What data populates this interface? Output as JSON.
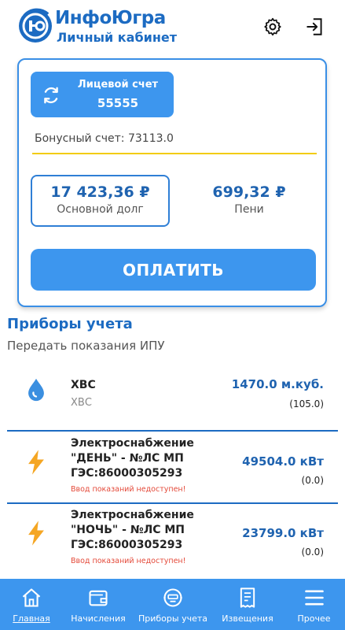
{
  "header": {
    "brand": "ИнфоЮгра",
    "subtitle": "Личный кабинет",
    "settings_icon": "gear-icon",
    "logout_icon": "logout-icon"
  },
  "account": {
    "label": "Лицевой счет",
    "number": "55555",
    "bonus": "Бонусный счет: 73113.0",
    "debt_amount": "17 423,36 ₽",
    "debt_label": "Основной долг",
    "peni_amount": "699,32 ₽",
    "peni_label": "Пени",
    "pay_label": "ОПЛАТИТЬ"
  },
  "meters": {
    "title": "Приборы учета",
    "subtitle": "Передать показания ИПУ",
    "items": [
      {
        "name": "ХВС",
        "sub": "ХВС",
        "value": "1470.0 м.куб.",
        "prev": "(105.0)",
        "icon": "water-drop-icon"
      },
      {
        "name": [
          "Электроснабжение",
          "\"ДЕНЬ\" - №ЛС МП",
          "ГЭС:86000305293"
        ],
        "warning": "Ввод показаний недоступен!",
        "value": "49504.0 кВт",
        "prev": "(0.0)",
        "icon": "lightning-icon"
      },
      {
        "name": [
          "Электроснабжение",
          "\"НОЧЬ\" - №ЛС МП",
          "ГЭС:86000305293"
        ],
        "warning": "Ввод показаний недоступен!",
        "value": "23799.0 кВт",
        "prev": "(0.0)",
        "icon": "lightning-icon"
      }
    ]
  },
  "nav": {
    "items": [
      {
        "label": "Главная",
        "icon": "home-icon",
        "active": true
      },
      {
        "label": "Начисления",
        "icon": "wallet-icon"
      },
      {
        "label": "Приборы учета",
        "icon": "meter-icon"
      },
      {
        "label": "Извещения",
        "icon": "receipt-icon"
      },
      {
        "label": "Прочее",
        "icon": "menu-icon"
      }
    ]
  },
  "colors": {
    "brand_blue": "#1c6bc2",
    "button_blue": "#3d96ee",
    "accent_yellow": "#f2cc0c",
    "warning_red": "#e44a3a",
    "bolt_orange": "#f5a623",
    "drop_blue": "#3b8fe0"
  }
}
